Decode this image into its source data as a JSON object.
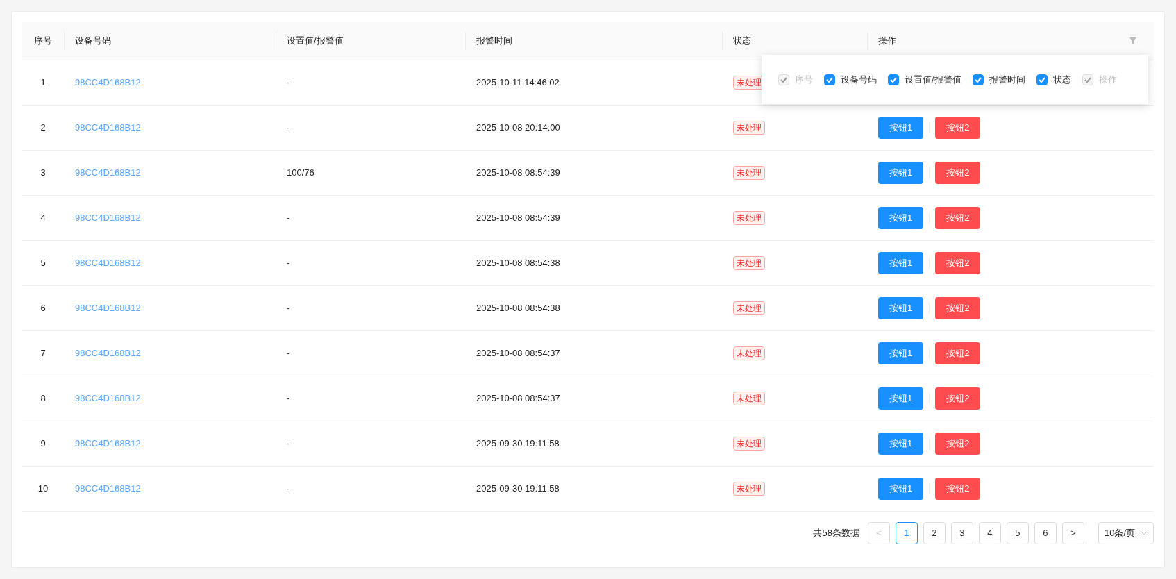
{
  "table": {
    "columns": [
      "序号",
      "设备号码",
      "设置值/报警值",
      "报警时间",
      "状态",
      "操作"
    ],
    "rows": [
      {
        "index": "1",
        "device": "98CC4D168B12",
        "value": "-",
        "time": "2025-10-11 14:46:02",
        "status": "未处理"
      },
      {
        "index": "2",
        "device": "98CC4D168B12",
        "value": "-",
        "time": "2025-10-08 20:14:00",
        "status": "未处理",
        "actions": [
          {
            "label": "按钮1",
            "kind": "primary"
          },
          {
            "label": "按钮2",
            "kind": "danger"
          }
        ]
      },
      {
        "index": "3",
        "device": "98CC4D168B12",
        "value": "100/76",
        "time": "2025-10-08 08:54:39",
        "status": "未处理",
        "actions": [
          {
            "label": "按钮1",
            "kind": "primary"
          },
          {
            "label": "按钮2",
            "kind": "danger"
          }
        ]
      },
      {
        "index": "4",
        "device": "98CC4D168B12",
        "value": "-",
        "time": "2025-10-08 08:54:39",
        "status": "未处理",
        "actions": [
          {
            "label": "按钮1",
            "kind": "primary"
          },
          {
            "label": "按钮2",
            "kind": "danger"
          }
        ]
      },
      {
        "index": "5",
        "device": "98CC4D168B12",
        "value": "-",
        "time": "2025-10-08 08:54:38",
        "status": "未处理",
        "actions": [
          {
            "label": "按钮1",
            "kind": "primary"
          },
          {
            "label": "按钮2",
            "kind": "danger"
          }
        ]
      },
      {
        "index": "6",
        "device": "98CC4D168B12",
        "value": "-",
        "time": "2025-10-08 08:54:38",
        "status": "未处理",
        "actions": [
          {
            "label": "按钮1",
            "kind": "primary"
          },
          {
            "label": "按钮2",
            "kind": "danger"
          }
        ]
      },
      {
        "index": "7",
        "device": "98CC4D168B12",
        "value": "-",
        "time": "2025-10-08 08:54:37",
        "status": "未处理",
        "actions": [
          {
            "label": "按钮1",
            "kind": "primary"
          },
          {
            "label": "按钮2",
            "kind": "danger"
          }
        ]
      },
      {
        "index": "8",
        "device": "98CC4D168B12",
        "value": "-",
        "time": "2025-10-08 08:54:37",
        "status": "未处理",
        "actions": [
          {
            "label": "按钮1",
            "kind": "primary"
          },
          {
            "label": "按钮2",
            "kind": "danger"
          }
        ]
      },
      {
        "index": "9",
        "device": "98CC4D168B12",
        "value": "-",
        "time": "2025-09-30 19:11:58",
        "status": "未处理",
        "actions": [
          {
            "label": "按钮1",
            "kind": "primary"
          },
          {
            "label": "按钮2",
            "kind": "danger"
          }
        ]
      },
      {
        "index": "10",
        "device": "98CC4D168B12",
        "value": "-",
        "time": "2025-09-30 19:11:58",
        "status": "未处理",
        "actions": [
          {
            "label": "按钮1",
            "kind": "primary"
          },
          {
            "label": "按钮2",
            "kind": "danger"
          }
        ]
      }
    ]
  },
  "column_picker": [
    {
      "label": "序号",
      "checked": true,
      "disabled": true
    },
    {
      "label": "设备号码",
      "checked": true,
      "disabled": false
    },
    {
      "label": "设置值/报警值",
      "checked": true,
      "disabled": false
    },
    {
      "label": "报警时间",
      "checked": true,
      "disabled": false
    },
    {
      "label": "状态",
      "checked": true,
      "disabled": false
    },
    {
      "label": "操作",
      "checked": true,
      "disabled": true
    }
  ],
  "pagination": {
    "total": "共58条数据",
    "prev": {
      "label": "<",
      "disabled": true
    },
    "pages": [
      {
        "label": "1",
        "selected": true
      },
      {
        "label": "2",
        "selected": false
      },
      {
        "label": "3",
        "selected": false
      },
      {
        "label": "4",
        "selected": false
      },
      {
        "label": "5",
        "selected": false
      },
      {
        "label": "6",
        "selected": false
      }
    ],
    "next": {
      "label": ">",
      "disabled": false
    },
    "page_size": "10条/页"
  }
}
